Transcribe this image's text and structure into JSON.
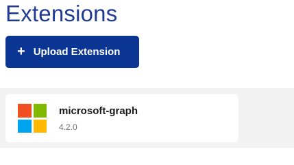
{
  "page": {
    "title": "Extensions"
  },
  "toolbar": {
    "upload_icon": "plus-icon",
    "upload_label": "Upload Extension",
    "plus_glyph": "+"
  },
  "extensions": [
    {
      "name": "microsoft-graph",
      "version": "4.2.0",
      "icon": "microsoft-logo-icon"
    }
  ],
  "colors": {
    "title": "#1f3a93",
    "button_bg": "#0b3593",
    "list_bg": "#f3f3f3",
    "ms_red": "#f25022",
    "ms_green": "#7fba00",
    "ms_blue": "#00a4ef",
    "ms_yellow": "#ffb900"
  }
}
